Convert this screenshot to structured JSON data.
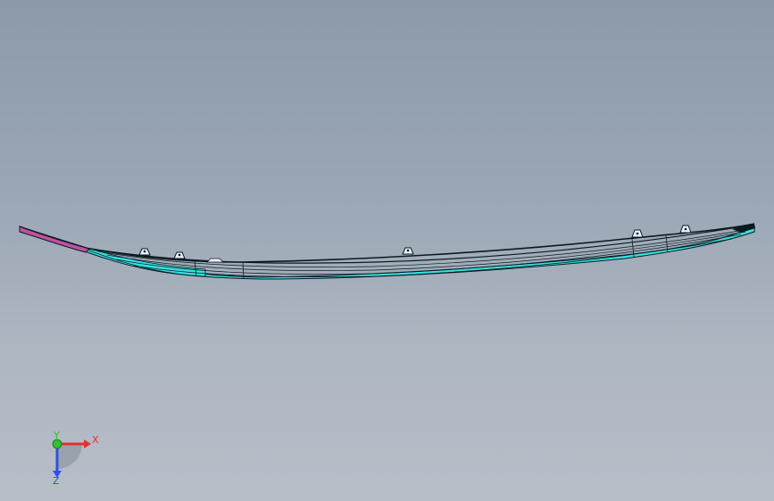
{
  "viewport": {
    "background_top": "#8c9aa9",
    "background_bottom": "#b8bec8"
  },
  "model": {
    "part_color": "#36e0e0",
    "edge_color": "#0a1a20",
    "tip_color": "#c050a0",
    "clip_count": 6
  },
  "triad": {
    "x_label": "X",
    "y_label": "Y",
    "z_label": "Z",
    "x_color": "#e03030",
    "y_color": "#30c030",
    "z_color": "#3050e0"
  }
}
